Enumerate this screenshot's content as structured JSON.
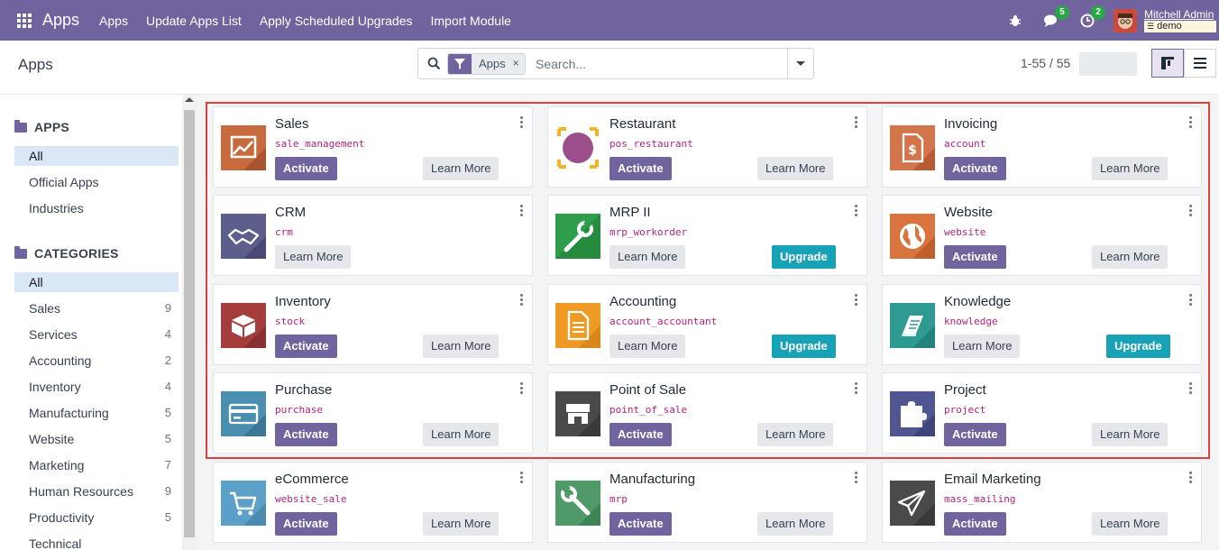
{
  "navbar": {
    "brand": "Apps",
    "menu": [
      "Apps",
      "Update Apps List",
      "Apply Scheduled Upgrades",
      "Import Module"
    ],
    "messages_count": "5",
    "activities_count": "2",
    "user_name": "Mitchell Admin",
    "database": "demo",
    "bg_color": "#71639e"
  },
  "control_panel": {
    "breadcrumb": "Apps",
    "facet": "Apps",
    "facet_remove": "×",
    "search_placeholder": "Search...",
    "pager": "1-55 / 55"
  },
  "sidebar": {
    "apps_heading": "APPS",
    "apps_items": [
      "All",
      "Official Apps",
      "Industries"
    ],
    "categories_heading": "CATEGORIES",
    "categories": [
      {
        "label": "All",
        "count": ""
      },
      {
        "label": "Sales",
        "count": "9"
      },
      {
        "label": "Services",
        "count": "4"
      },
      {
        "label": "Accounting",
        "count": "2"
      },
      {
        "label": "Inventory",
        "count": "4"
      },
      {
        "label": "Manufacturing",
        "count": "5"
      },
      {
        "label": "Website",
        "count": "5"
      },
      {
        "label": "Marketing",
        "count": "7"
      },
      {
        "label": "Human Resources",
        "count": "9"
      },
      {
        "label": "Productivity",
        "count": "5"
      },
      {
        "label": "Technical",
        "count": ""
      }
    ]
  },
  "apps": [
    {
      "name": "Sales",
      "tech": "sale_management",
      "left_button": "Activate",
      "right_button": "Learn More",
      "icon": "sales-chart-icon",
      "color": "#c76a3e"
    },
    {
      "name": "Restaurant",
      "tech": "pos_restaurant",
      "left_button": "Activate",
      "right_button": "Learn More",
      "icon": "restaurant-plate-icon",
      "color": "#9c4f8a"
    },
    {
      "name": "Invoicing",
      "tech": "account",
      "left_button": "Activate",
      "right_button": "Learn More",
      "icon": "invoice-dollar-icon",
      "color": "#d3744a"
    },
    {
      "name": "CRM",
      "tech": "crm",
      "left_button": "Learn More",
      "right_button": "",
      "icon": "handshake-icon",
      "color": "#5c5e8c"
    },
    {
      "name": "MRP II",
      "tech": "mrp_workorder",
      "left_button": "Learn More",
      "right_button": "Upgrade",
      "icon": "wrench-icon",
      "color": "#2e9e4a"
    },
    {
      "name": "Website",
      "tech": "website",
      "left_button": "Activate",
      "right_button": "Learn More",
      "icon": "globe-icon",
      "color": "#d9743f"
    },
    {
      "name": "Inventory",
      "tech": "stock",
      "left_button": "Activate",
      "right_button": "Learn More",
      "icon": "box-icon",
      "color": "#a53d3d"
    },
    {
      "name": "Accounting",
      "tech": "account_accountant",
      "left_button": "Learn More",
      "right_button": "Upgrade",
      "icon": "document-icon",
      "color": "#ef9a22"
    },
    {
      "name": "Knowledge",
      "tech": "knowledge",
      "left_button": "Learn More",
      "right_button": "Upgrade",
      "icon": "book-icon",
      "color": "#2f9a92"
    },
    {
      "name": "Purchase",
      "tech": "purchase",
      "left_button": "Activate",
      "right_button": "Learn More",
      "icon": "credit-card-icon",
      "color": "#4a8fb0"
    },
    {
      "name": "Point of Sale",
      "tech": "point_of_sale",
      "left_button": "Activate",
      "right_button": "Learn More",
      "icon": "shop-icon",
      "color": "#4a4a4a"
    },
    {
      "name": "Project",
      "tech": "project",
      "left_button": "Activate",
      "right_button": "Learn More",
      "icon": "puzzle-icon",
      "color": "#4f5691"
    },
    {
      "name": "eCommerce",
      "tech": "website_sale",
      "left_button": "Activate",
      "right_button": "Learn More",
      "icon": "cart-icon",
      "color": "#5ba0c9"
    },
    {
      "name": "Manufacturing",
      "tech": "mrp",
      "left_button": "Activate",
      "right_button": "Learn More",
      "icon": "wrench-icon",
      "color": "#4f9a68"
    },
    {
      "name": "Email Marketing",
      "tech": "mass_mailing",
      "left_button": "Activate",
      "right_button": "Learn More",
      "icon": "paper-plane-icon",
      "color": "#4a4a4a"
    }
  ]
}
